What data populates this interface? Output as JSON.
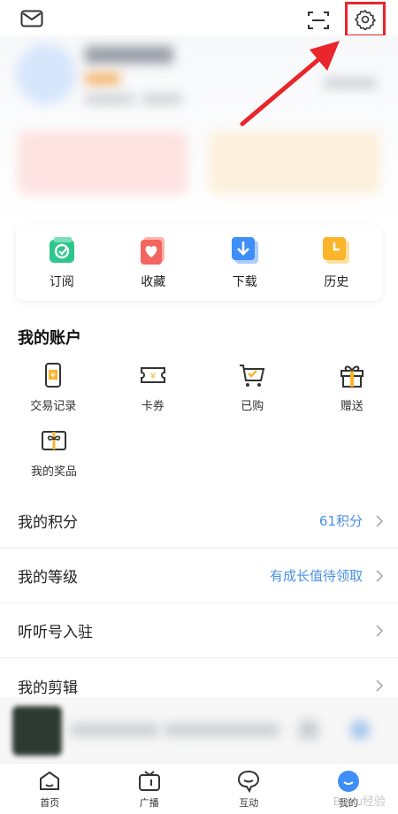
{
  "top_bar": {
    "icons": [
      "mail-icon",
      "scan-icon",
      "settings-gear-icon"
    ]
  },
  "annotation": {
    "highlight_color": "#e8262b"
  },
  "quick_tiles": [
    {
      "label": "订阅",
      "icon": "subscribe-icon",
      "color": "#2dc68d"
    },
    {
      "label": "收藏",
      "icon": "favorite-icon",
      "color": "#f4655f"
    },
    {
      "label": "下载",
      "icon": "download-icon",
      "color": "#3e8ef7"
    },
    {
      "label": "历史",
      "icon": "history-icon",
      "color": "#fbb52b"
    }
  ],
  "account": {
    "title": "我的账户",
    "items": [
      {
        "label": "交易记录",
        "icon": "transaction-record-icon"
      },
      {
        "label": "卡券",
        "icon": "coupon-icon"
      },
      {
        "label": "已购",
        "icon": "cart-icon"
      },
      {
        "label": "赠送",
        "icon": "gift-icon"
      },
      {
        "label": "我的奖品",
        "icon": "prize-icon"
      }
    ]
  },
  "list": [
    {
      "label": "我的积分",
      "value": "61积分"
    },
    {
      "label": "我的等级",
      "value": "有成长值待领取"
    },
    {
      "label": "听听号入驻",
      "value": ""
    },
    {
      "label": "我的剪辑",
      "value": ""
    }
  ],
  "tabs": [
    {
      "label": "首页",
      "icon": "home-icon"
    },
    {
      "label": "广播",
      "icon": "radio-icon"
    },
    {
      "label": "互动",
      "icon": "chat-icon"
    },
    {
      "label": "我的",
      "icon": "profile-icon",
      "active": true
    }
  ],
  "watermark": "Baidu经验",
  "accent_blue": "#4a90e2"
}
